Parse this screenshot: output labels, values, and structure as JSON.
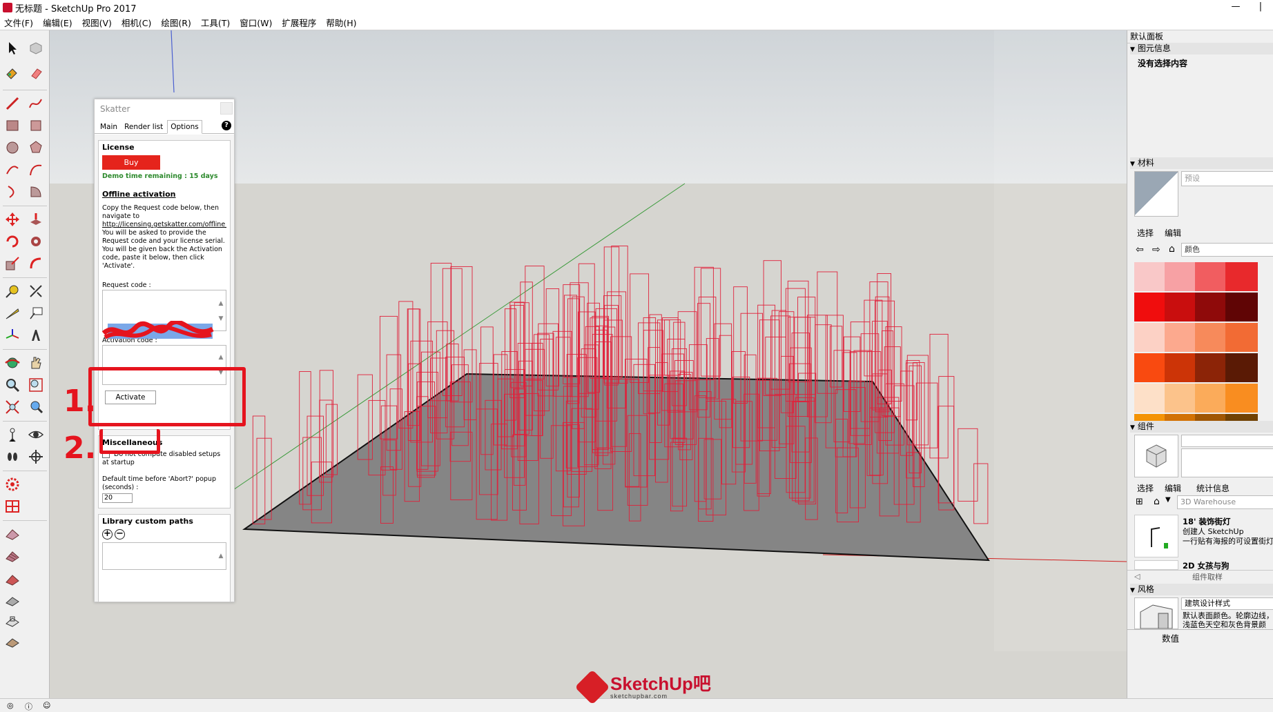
{
  "window": {
    "title": "无标题 - SketchUp Pro 2017",
    "minimize_glyph": "—",
    "close_glyph": "|"
  },
  "menubar": {
    "items": [
      "文件(F)",
      "编辑(E)",
      "视图(V)",
      "相机(C)",
      "绘图(R)",
      "工具(T)",
      "窗口(W)",
      "扩展程序",
      "帮助(H)"
    ]
  },
  "skatter": {
    "title": "Skatter",
    "tabs": [
      "Main",
      "Render list",
      "Options"
    ],
    "active_tab": "Options",
    "help": "?",
    "license": {
      "heading": "License",
      "buy_label": "Buy",
      "demo_text": "Demo time remaining : 15 days",
      "offline_heading": "Offline activation",
      "instructions_1": "Copy the Request code below, then navigate to",
      "link": "http://licensing.getskatter.com/offline_ac",
      "instructions_2": "You will be asked to provide the Request code and your license serial.",
      "instructions_3": "You will be given back the Activation code, paste it below, then click 'Activate'.",
      "request_label": "Request code :",
      "activation_label": "Activation code :",
      "activate_label": "Activate"
    },
    "misc": {
      "heading": "Miscellaneous",
      "checkbox_label": "Do not compute disabled setups at startup",
      "checkbox_checked": false,
      "timeout_label": "Default time before 'Abort?' popup (seconds) :",
      "timeout_value": "20"
    },
    "library": {
      "heading": "Library custom paths"
    }
  },
  "annotations": {
    "step1": "1.",
    "step2": "2."
  },
  "right_panel": {
    "tray_title": "默认面板",
    "entity_info": {
      "header": "图元信息",
      "content": "没有选择内容"
    },
    "materials": {
      "header": "材料",
      "name_placeholder": "预设",
      "tabs": [
        "选择",
        "编辑"
      ],
      "collection": "颜色",
      "swatches": [
        "#f9c8c8",
        "#f7a1a4",
        "#f15d60",
        "#e8292c",
        "#f00d0d",
        "#c90e0e",
        "#8f0a0a",
        "#600505",
        "#fcd1c5",
        "#fca98e",
        "#f78a5b",
        "#f26b34",
        "#f94a10",
        "#cc3407",
        "#8c2407",
        "#5a1a05",
        "#fde0c8",
        "#fcc38b",
        "#fbab5a",
        "#f98d20",
        "#f49305",
        "#d27204",
        "#a05704",
        "#714203"
      ]
    },
    "components": {
      "header": "组件",
      "tabs": [
        "选择",
        "编辑",
        "统计信息"
      ],
      "search_placeholder": "3D Warehouse",
      "item1_title": "18' 装饰街灯",
      "item1_author": "创建人 SketchUp",
      "item1_desc": "一行贴有海报的可设置街灯",
      "item2_title": "2D 女孩与狗",
      "sample_label": "组件取样"
    },
    "styles": {
      "header": "风格",
      "style_name": "建筑设计样式",
      "style_desc": "默认表面颜色。轮廓边线，浅蓝色天空和灰色背景颜"
    },
    "bottom_tab": "数值"
  },
  "watermark": {
    "brand": "SketchUp吧",
    "url": "sketchupbar.com"
  },
  "colors": {
    "accent_red": "#e5141e",
    "buy_red": "#e5241c",
    "demo_green": "#2d8a2d",
    "scatter_red": "#e0203a"
  }
}
